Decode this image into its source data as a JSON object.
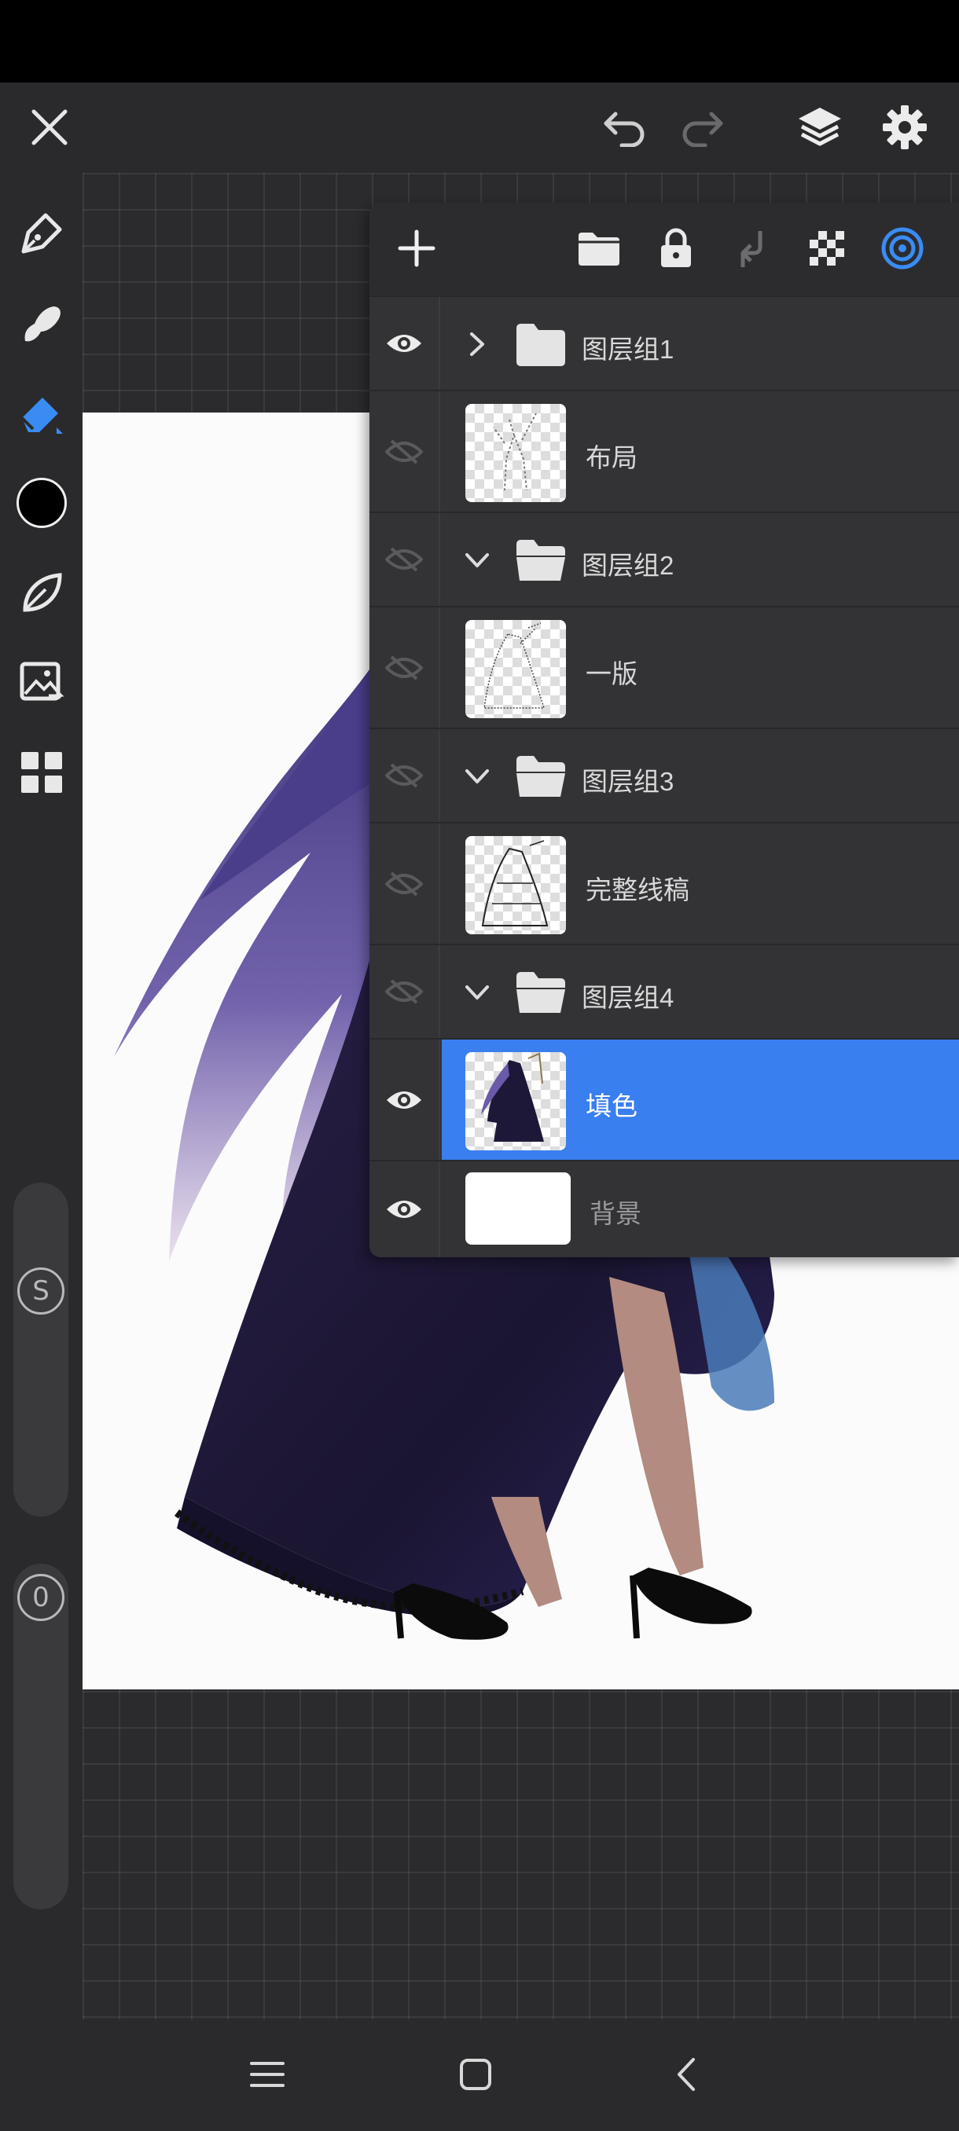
{
  "app": {
    "accent": "#3a7ff0",
    "background": "#2a2a2c"
  },
  "left_toolbar": {
    "tools": [
      {
        "name": "pen-tool",
        "icon": "pen-icon"
      },
      {
        "name": "smudge-tool",
        "icon": "smudge-icon"
      },
      {
        "name": "eraser-tool",
        "icon": "eraser-icon",
        "active": true
      },
      {
        "name": "color-picker",
        "icon": "color-swatch",
        "color": "#000000"
      },
      {
        "name": "selection-tool",
        "icon": "lasso-leaf-icon"
      },
      {
        "name": "image-tool",
        "icon": "image-icon"
      },
      {
        "name": "more-tools",
        "icon": "grid-icon"
      }
    ],
    "size_slider_label": "S",
    "opacity_slider_label": "0"
  },
  "layers_panel": {
    "layers": [
      {
        "type": "group",
        "name": "图层组1",
        "expanded": false,
        "visible": true
      },
      {
        "type": "layer",
        "name": "布局",
        "visible": false
      },
      {
        "type": "group",
        "name": "图层组2",
        "expanded": true,
        "visible": false
      },
      {
        "type": "layer",
        "name": "一版",
        "visible": false
      },
      {
        "type": "group",
        "name": "图层组3",
        "expanded": true,
        "visible": false
      },
      {
        "type": "layer",
        "name": "完整线稿",
        "visible": false
      },
      {
        "type": "group",
        "name": "图层组4",
        "expanded": true,
        "visible": false
      },
      {
        "type": "layer",
        "name": "填色",
        "visible": true,
        "selected": true
      },
      {
        "type": "background",
        "name": "背景",
        "visible": true
      }
    ]
  }
}
